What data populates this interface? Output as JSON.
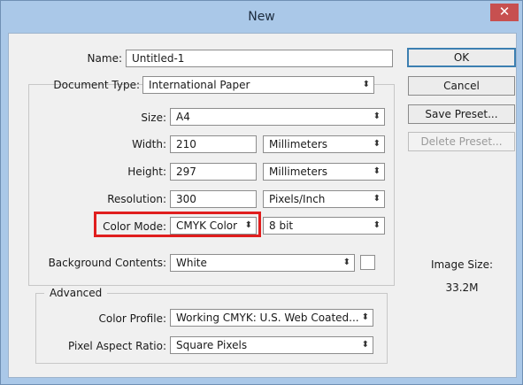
{
  "window": {
    "title": "New",
    "close_glyph": "✕"
  },
  "form": {
    "name_label": "Name:",
    "name_value": "Untitled-1",
    "document_type_label": "Document Type:",
    "document_type_value": "International Paper",
    "size_label": "Size:",
    "size_value": "A4",
    "width_label": "Width:",
    "width_value": "210",
    "width_unit": "Millimeters",
    "height_label": "Height:",
    "height_value": "297",
    "height_unit": "Millimeters",
    "resolution_label": "Resolution:",
    "resolution_value": "300",
    "resolution_unit": "Pixels/Inch",
    "color_mode_label": "Color Mode:",
    "color_mode_value": "CMYK Color",
    "bit_depth_value": "8 bit",
    "background_label": "Background Contents:",
    "background_value": "White",
    "advanced_label": "Advanced",
    "color_profile_label": "Color Profile:",
    "color_profile_value": "Working CMYK:  U.S. Web Coated...",
    "pixel_aspect_label": "Pixel Aspect Ratio:",
    "pixel_aspect_value": "Square Pixels"
  },
  "buttons": {
    "ok": "OK",
    "cancel": "Cancel",
    "save_preset": "Save Preset...",
    "delete_preset": "Delete Preset..."
  },
  "info": {
    "image_size_label": "Image Size:",
    "image_size_value": "33.2M"
  },
  "icons": {
    "caret": "⬍",
    "close": "close-icon",
    "select_arrow": "updown-arrow-icon"
  },
  "colors": {
    "highlight": "#e01e1e",
    "default_button_border": "#3c7fb1",
    "titlebar": "#aac8e8",
    "close_button": "#c75050"
  }
}
